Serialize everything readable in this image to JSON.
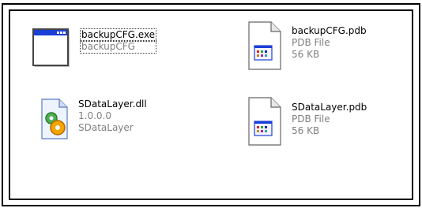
{
  "files": [
    {
      "name": "backupCFG.exe",
      "line2": "backupCFG",
      "line3": "",
      "icon": "exe-window-icon"
    },
    {
      "name": "backupCFG.pdb",
      "line2": "PDB File",
      "line3": "56 KB",
      "icon": "pdb-file-icon"
    },
    {
      "name": "SDataLayer.dll",
      "line2": "1.0.0.0",
      "line3": "SDataLayer",
      "icon": "dll-gear-icon"
    },
    {
      "name": "SDataLayer.pdb",
      "line2": "PDB File",
      "line3": "56 KB",
      "icon": "pdb-file-icon"
    }
  ]
}
